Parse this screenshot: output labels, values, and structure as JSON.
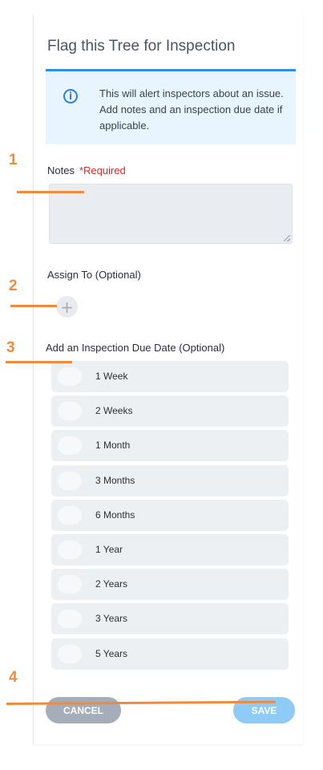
{
  "dialog": {
    "title": "Flag this Tree for Inspection",
    "info_text": "This will alert inspectors about an issue. Add notes and an inspection due date if applicable."
  },
  "notes": {
    "label": "Notes",
    "required_text": "*Required",
    "value": ""
  },
  "assign": {
    "label": "Assign To (Optional)",
    "add_symbol": "+"
  },
  "due_date": {
    "label": "Add an Inspection Due Date (Optional)",
    "options": [
      "1 Week",
      "2 Weeks",
      "1 Month",
      "3 Months",
      "6 Months",
      "1 Year",
      "2 Years",
      "3 Years",
      "5 Years"
    ]
  },
  "actions": {
    "cancel_label": "CANCEL",
    "save_label": "SAVE"
  },
  "annotations": [
    "1",
    "2",
    "3",
    "4"
  ],
  "colors": {
    "accent": "#2f8fe6",
    "annotation": "#f28a3c",
    "required": "#d92b2b"
  },
  "icons": {
    "info": "info-circle-icon",
    "add": "plus-icon"
  }
}
